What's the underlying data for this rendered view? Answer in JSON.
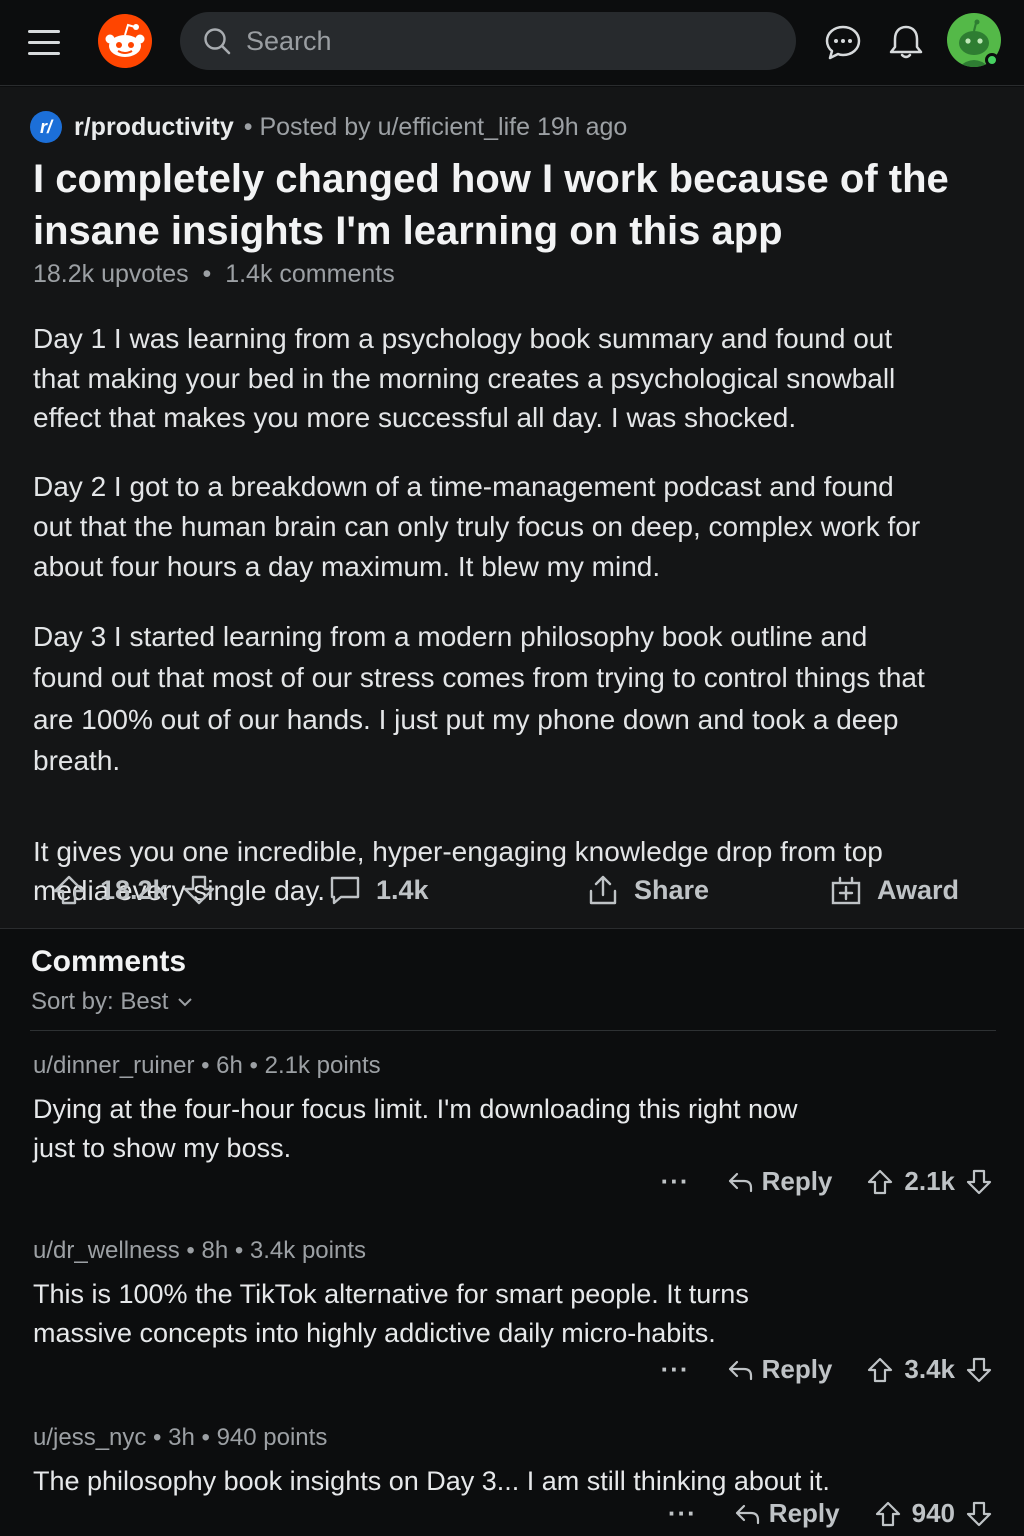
{
  "topbar": {
    "search_placeholder": "Search",
    "accent": "#ff4500"
  },
  "post": {
    "subreddit": "r/productivity",
    "sub_icon_text": "r/",
    "posted_by": "• Posted by u/efficient_life 19h ago",
    "title": "I completely changed how I work because of the insane insights I'm learning on this app",
    "stats": "18.2k upvotes  •  1.4k comments",
    "body": [
      "Day 1 I was learning from a psychology book summary and found out that making your bed in the morning creates a psychological snowball effect that makes you more successful all day. I was shocked.",
      "Day 2 I got to a breakdown of a time-management podcast and found out that the human brain can only truly focus on deep, complex work for about four hours a day maximum. It blew my mind.",
      "Day 3 I started learning from a modern philosophy book outline and found out that most of our stress comes from trying to control things that are 100% out of our hands. I just put my phone down and took a deep breath.",
      "It gives you one incredible, hyper-engaging knowledge drop from top media every single day."
    ],
    "actions": {
      "votes": "18.2k",
      "comments": "1.4k",
      "share": "Share",
      "award": "Award"
    }
  },
  "comments_section": {
    "title": "Comments",
    "sort_label": "Sort by: Best",
    "items": [
      {
        "meta": "u/dinner_ruiner • 6h • 2.1k points",
        "text": "Dying at the four-hour focus limit. I'm downloading this right now just to show my boss.",
        "more": "···",
        "reply": "Reply",
        "votes": "2.1k"
      },
      {
        "meta": "u/dr_wellness • 8h • 3.4k points",
        "text": "This is 100% the TikTok alternative for smart people. It turns massive concepts into highly addictive daily micro-habits.",
        "more": "···",
        "reply": "Reply",
        "votes": "3.4k"
      },
      {
        "meta": "u/jess_nyc • 3h • 940 points",
        "text": "The philosophy book insights on Day 3... I am still thinking about it.",
        "more": "···",
        "reply": "Reply",
        "votes": "940"
      }
    ]
  }
}
